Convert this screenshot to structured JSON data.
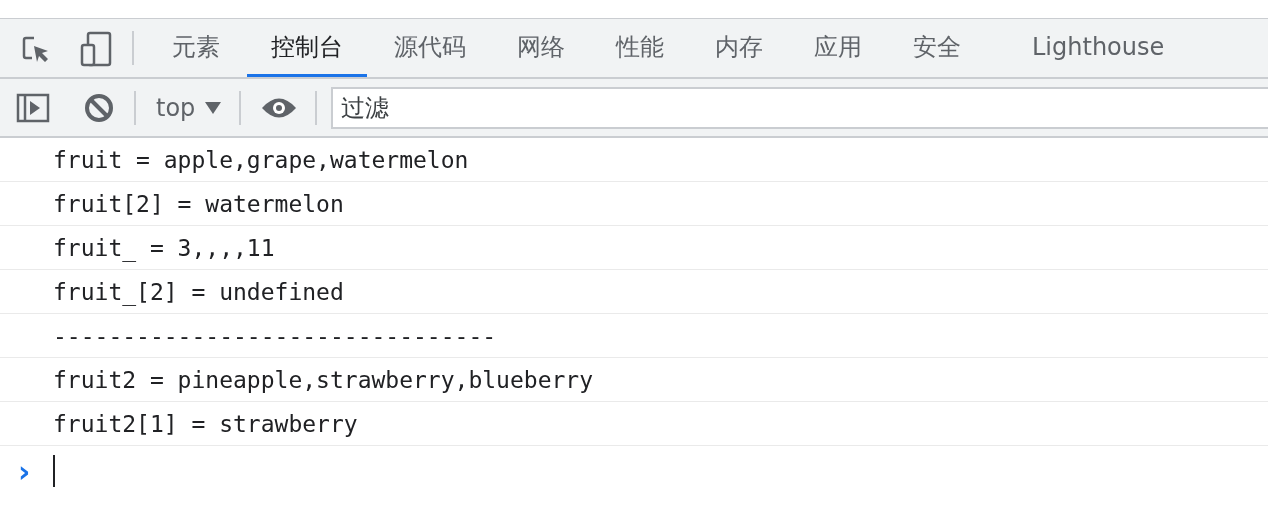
{
  "tabs": [
    {
      "label": "元素",
      "selected": false
    },
    {
      "label": "控制台",
      "selected": true
    },
    {
      "label": "源代码",
      "selected": false
    },
    {
      "label": "网络",
      "selected": false
    },
    {
      "label": "性能",
      "selected": false
    },
    {
      "label": "内存",
      "selected": false
    },
    {
      "label": "应用",
      "selected": false
    },
    {
      "label": "安全",
      "selected": false
    },
    {
      "label": "Lighthouse",
      "selected": false
    }
  ],
  "toolbar": {
    "context": "top",
    "filter": {
      "placeholder": "过滤"
    }
  },
  "console_lines": [
    "fruit = apple,grape,watermelon",
    "fruit[2] = watermelon",
    "fruit_ = 3,,,,11",
    "fruit_[2] = undefined",
    "--------------------------------",
    "fruit2 = pineapple,strawberry,blueberry",
    "fruit2[1] = strawberry"
  ],
  "prompt": {
    "symbol": "›"
  }
}
